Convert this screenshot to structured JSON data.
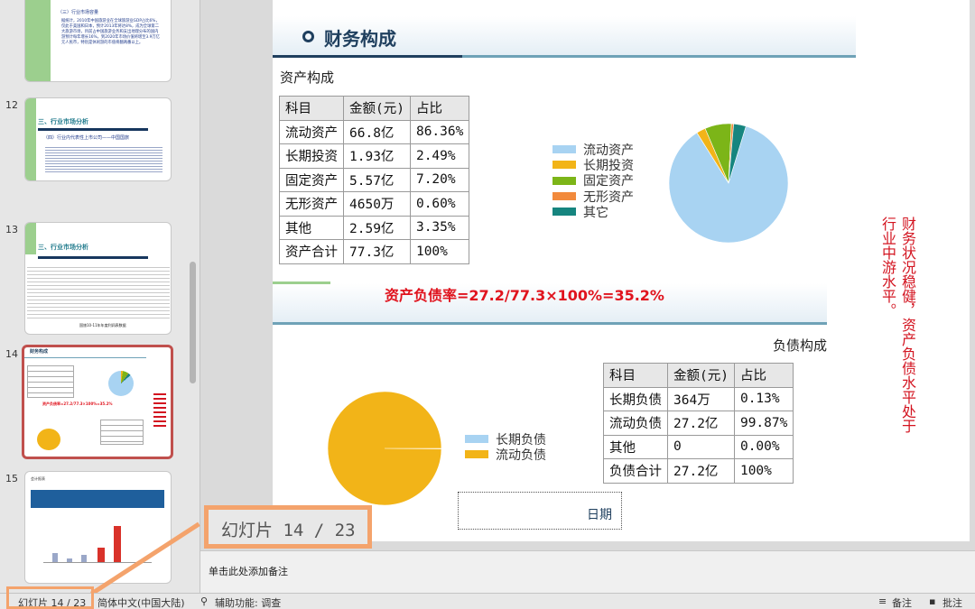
{
  "sidebar": {
    "thumbs": [
      {
        "number": "",
        "title": "（三）行业市场容量",
        "text": "据统计，2010年中国旅游业在全球旅游业GDP占比6%，仅此于美国和日本，预计2013年将达8%，成为全球第二大旅游市场，目前占中国旅游业务和支出地理分布的国内游预计每年增长16%，到2020年市场价值将增至3.9万亿元人民币，特别是休闲游的市值将翻两番以上。"
      },
      {
        "number": "12",
        "title": "三、行业市场分析",
        "subtitle": "（四）行业内代表性上市公司——中国国旅"
      },
      {
        "number": "13",
        "title": "三、行业市场分析",
        "caption": "国旅10-11年年度利润表数据"
      },
      {
        "number": "14",
        "title": "财务构成",
        "formula": "资产负债率=27.2/77.3×100%=35.2%"
      },
      {
        "number": "15",
        "title": "会计报表"
      }
    ]
  },
  "slide": {
    "title": "财务构成",
    "asset_heading": "资产构成",
    "asset_table": {
      "headers": [
        "科目",
        "金额(元)",
        "占比"
      ],
      "rows": [
        [
          "流动资产",
          "66.8亿",
          "86.36%"
        ],
        [
          "长期投资",
          "1.93亿",
          "2.49%"
        ],
        [
          "固定资产",
          "5.57亿",
          "7.20%"
        ],
        [
          "无形资产",
          "4650万",
          "0.60%"
        ],
        [
          "其他",
          "2.59亿",
          "3.35%"
        ],
        [
          "资产合计",
          "77.3亿",
          "100%"
        ]
      ]
    },
    "asset_legend": [
      {
        "label": "流动资产",
        "color": "#a8d3f2"
      },
      {
        "label": "长期投资",
        "color": "#f2b418"
      },
      {
        "label": "固定资产",
        "color": "#7cb518"
      },
      {
        "label": "无形资产",
        "color": "#f28a3c"
      },
      {
        "label": "其它",
        "color": "#16857f"
      }
    ],
    "formula": "资产负债率=27.2/77.3×100%=35.2%",
    "liability_heading": "负债构成",
    "liability_table": {
      "headers": [
        "科目",
        "金额(元)",
        "占比"
      ],
      "rows": [
        [
          "长期负债",
          "364万",
          "0.13%"
        ],
        [
          "流动负债",
          "27.2亿",
          "99.87%"
        ],
        [
          "其他",
          "0",
          "0.00%"
        ],
        [
          "负债合计",
          "27.2亿",
          "100%"
        ]
      ]
    },
    "liability_legend": [
      {
        "label": "长期负债",
        "color": "#a8d3f2"
      },
      {
        "label": "流动负债",
        "color": "#f2b418"
      }
    ],
    "vertical_note": "财务状况稳健，资产负债水平处于行业中游水平。",
    "date_label": "日期"
  },
  "chart_data": [
    {
      "type": "pie",
      "categories": [
        "流动资产",
        "长期投资",
        "固定资产",
        "无形资产",
        "其它"
      ],
      "values": [
        86.36,
        2.49,
        7.2,
        0.6,
        3.35
      ],
      "colors": [
        "#a8d3f2",
        "#f2b418",
        "#7cb518",
        "#f28a3c",
        "#16857f"
      ]
    },
    {
      "type": "pie",
      "categories": [
        "长期负债",
        "流动负债"
      ],
      "values": [
        0.13,
        99.87
      ],
      "colors": [
        "#a8d3f2",
        "#f2b418"
      ]
    }
  ],
  "callout": {
    "text": "幻灯片 14 / 23"
  },
  "notes": {
    "placeholder": "单击此处添加备注"
  },
  "statusbar": {
    "slide_counter": "幻灯片 14 / 23",
    "language": "简体中文(中国大陆)",
    "accessibility": "辅助功能: 调查",
    "notes_label": "备注",
    "comments_label": "批注"
  }
}
